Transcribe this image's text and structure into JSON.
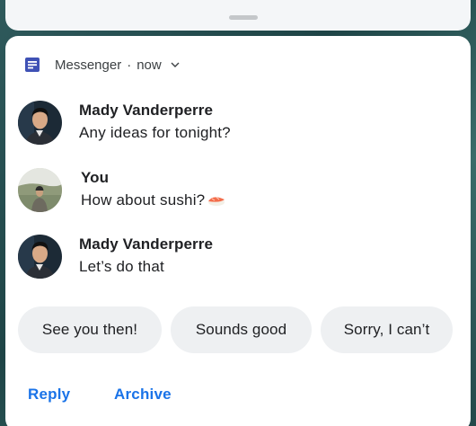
{
  "notification": {
    "app_name": "Messenger",
    "separator": "·",
    "time": "now",
    "icons": {
      "app": "messenger-app-icon",
      "expand": "chevron-down-icon"
    },
    "accent_color": "#3f51b5",
    "messages": [
      {
        "sender": "Mady Vanderperre",
        "text": "Any ideas for tonight?",
        "avatar": "mady-avatar"
      },
      {
        "sender": "You",
        "text": "How about sushi?",
        "emoji": "sushi-emoji",
        "avatar": "you-avatar"
      },
      {
        "sender": "Mady Vanderperre",
        "text": "Let’s do that",
        "avatar": "mady-avatar"
      }
    ],
    "smart_replies": [
      "See you then!",
      "Sounds good",
      "Sorry, I can’t"
    ],
    "actions": [
      "Reply",
      "Archive"
    ],
    "action_color": "#1a73e8"
  }
}
